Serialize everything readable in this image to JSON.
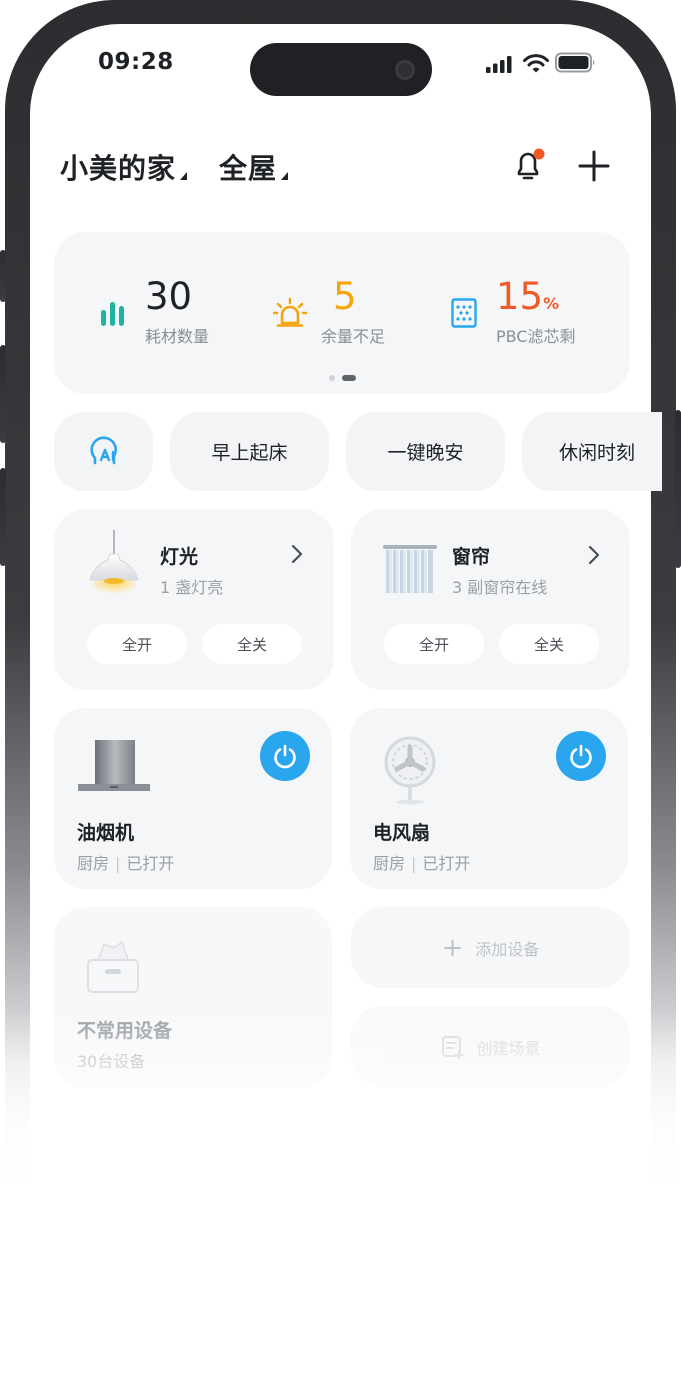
{
  "status_bar": {
    "time": "09:28"
  },
  "header": {
    "home_name": "小美的家",
    "room_filter": "全屋"
  },
  "stats": [
    {
      "value": "30",
      "unit": "",
      "label": "耗材数量",
      "color": "#1fb3a2",
      "icon": "bar-chart-icon"
    },
    {
      "value": "5",
      "unit": "",
      "label": "余量不足",
      "color": "#f5a40c",
      "icon": "alarm-light-icon"
    },
    {
      "value": "15",
      "unit": "%",
      "label": "PBC滤芯剩",
      "color": "#f05a28",
      "icon": "filter-icon"
    }
  ],
  "scenes": {
    "ai_icon": "ai-assistant-icon",
    "items": [
      {
        "label": "早上起床"
      },
      {
        "label": "一键晚安"
      },
      {
        "label": "休闲时刻"
      }
    ]
  },
  "groups": {
    "light": {
      "name": "灯光",
      "status": "1 盏灯亮",
      "on_label": "全开",
      "off_label": "全关",
      "icon": "pendant-lamp-icon"
    },
    "curtain": {
      "name": "窗帘",
      "status": "3 副窗帘在线",
      "on_label": "全开",
      "off_label": "全关",
      "icon": "curtain-icon"
    }
  },
  "devices": [
    {
      "name": "油烟机",
      "room": "厨房",
      "state": "已打开",
      "icon": "range-hood-icon"
    },
    {
      "name": "电风扇",
      "room": "厨房",
      "state": "已打开",
      "icon": "fan-icon"
    }
  ],
  "rare": {
    "name": "不常用设备",
    "count": "30台设备",
    "icon": "storage-box-icon"
  },
  "actions": {
    "add_device": "添加设备",
    "create_scene": "创建场景"
  },
  "colors": {
    "accent": "#2aa6ee",
    "card": "#f5f6f7"
  }
}
